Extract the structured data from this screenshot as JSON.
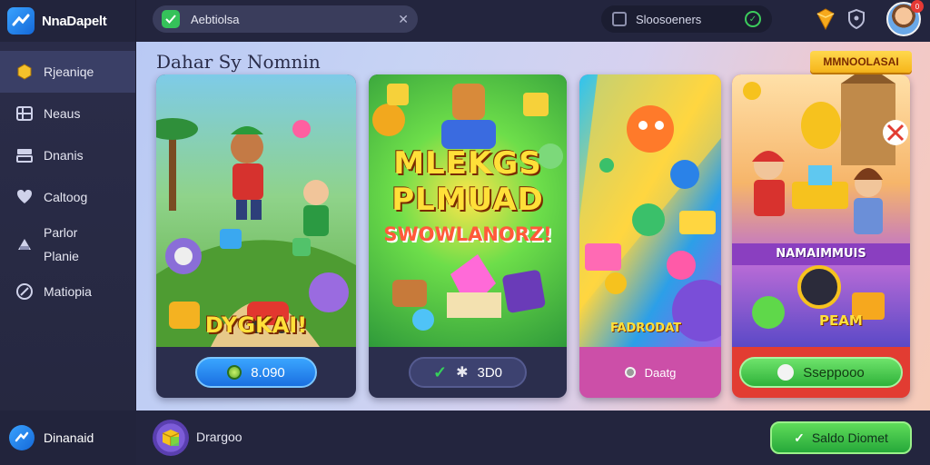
{
  "brand": {
    "name": "NnaDapelt"
  },
  "sidebar": {
    "items": [
      {
        "label": "Rjeaniqe",
        "icon": "badge-icon"
      },
      {
        "label": "Neaus",
        "icon": "grid-icon"
      },
      {
        "label": "Dnanis",
        "icon": "layers-icon"
      },
      {
        "label": "Caltoog",
        "icon": "heart-icon"
      },
      {
        "label": "Parlor\nPlanie",
        "icon": "game-icon"
      },
      {
        "label": "Matiopia",
        "icon": "compass-icon"
      }
    ],
    "footer_label": "Dinanaid"
  },
  "topbar": {
    "search_value": "Aebtiolsa",
    "status_text": "Sloosoeners",
    "avatar_badge": "0"
  },
  "main": {
    "title": "Dahar Sy Nomnin",
    "promo_badge": "MMNOOLASAI",
    "cards": [
      {
        "art_text": "DYGKAI!",
        "button_label": "8.090"
      },
      {
        "art_line1": "MLEKGS",
        "art_line2": "PLMUAD",
        "art_line3": "SWOWLANORZ!",
        "button_label": "3D0"
      },
      {
        "art_text": "FADRODAT",
        "button_label": "Daatg"
      },
      {
        "art_banner": "NAMAIMMUIS",
        "art_text": "PEAM",
        "button_label": "Sseppooo"
      }
    ]
  },
  "bottombar": {
    "label": "Drargoo",
    "button_label": "Saldo Diomet"
  },
  "colors": {
    "accent_blue": "#1a6fe0",
    "accent_green": "#2fb23a",
    "sidebar_bg": "#2b2d4a"
  }
}
